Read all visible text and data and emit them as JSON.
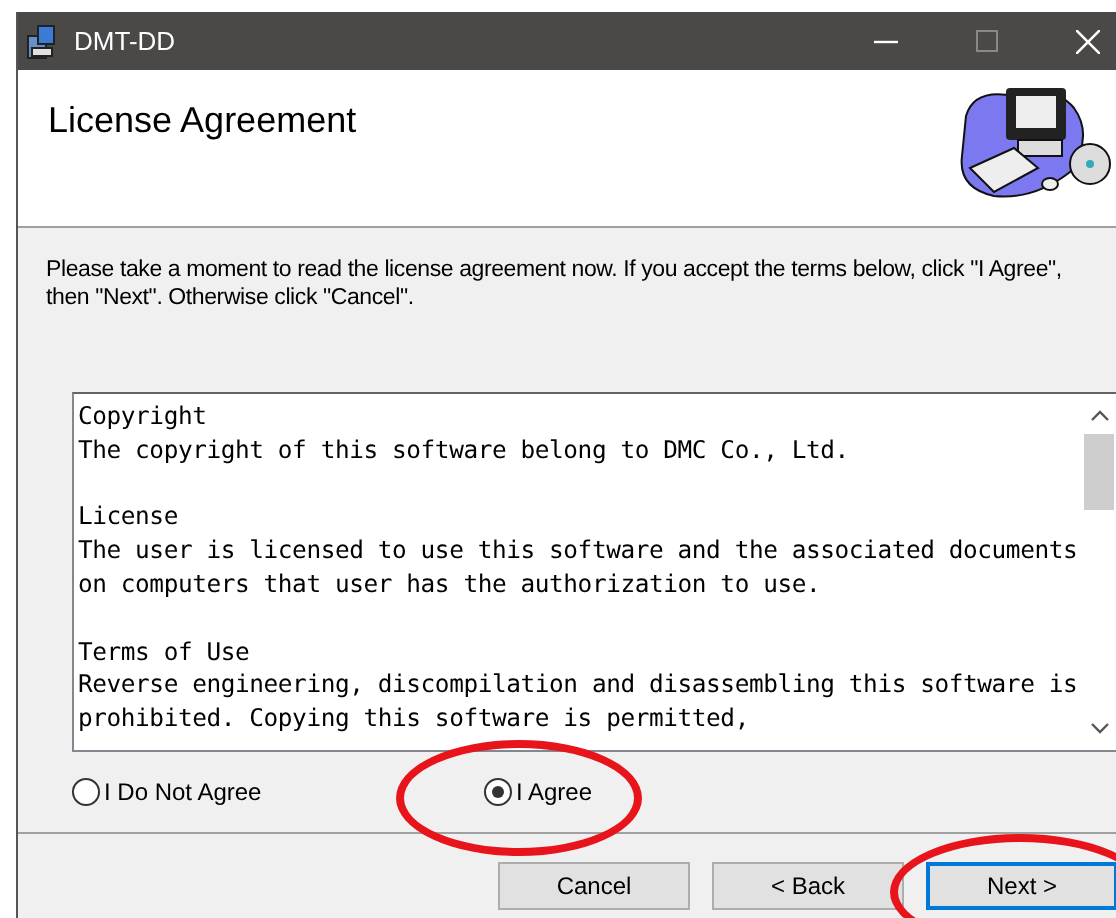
{
  "window": {
    "title": "DMT-DD"
  },
  "header": {
    "title": "License Agreement"
  },
  "intro": "Please take a moment to read the license agreement now. If you accept the terms below, click \"I Agree\", then \"Next\". Otherwise click \"Cancel\".",
  "license_text": [
    {
      "heading": "Copyright",
      "body": "The copyright of this software belong to DMC Co., Ltd."
    },
    {
      "heading": "License",
      "body": "The user is licensed to use this software and the associated documents on computers that user has the authorization to use."
    },
    {
      "heading": "Terms of Use",
      "body": "Reverse engineering, discompilation and disassembling this software is prohibited. Copying this software is permitted,"
    }
  ],
  "radios": [
    {
      "label": "I Do Not Agree",
      "selected": false,
      "circled": false
    },
    {
      "label": "I Agree",
      "selected": true,
      "circled": true
    }
  ],
  "buttons": [
    {
      "label": "Cancel",
      "focused": false,
      "circled": false
    },
    {
      "label": "< Back",
      "focused": false,
      "circled": false
    },
    {
      "label": "Next >",
      "focused": true,
      "circled": true
    }
  ]
}
